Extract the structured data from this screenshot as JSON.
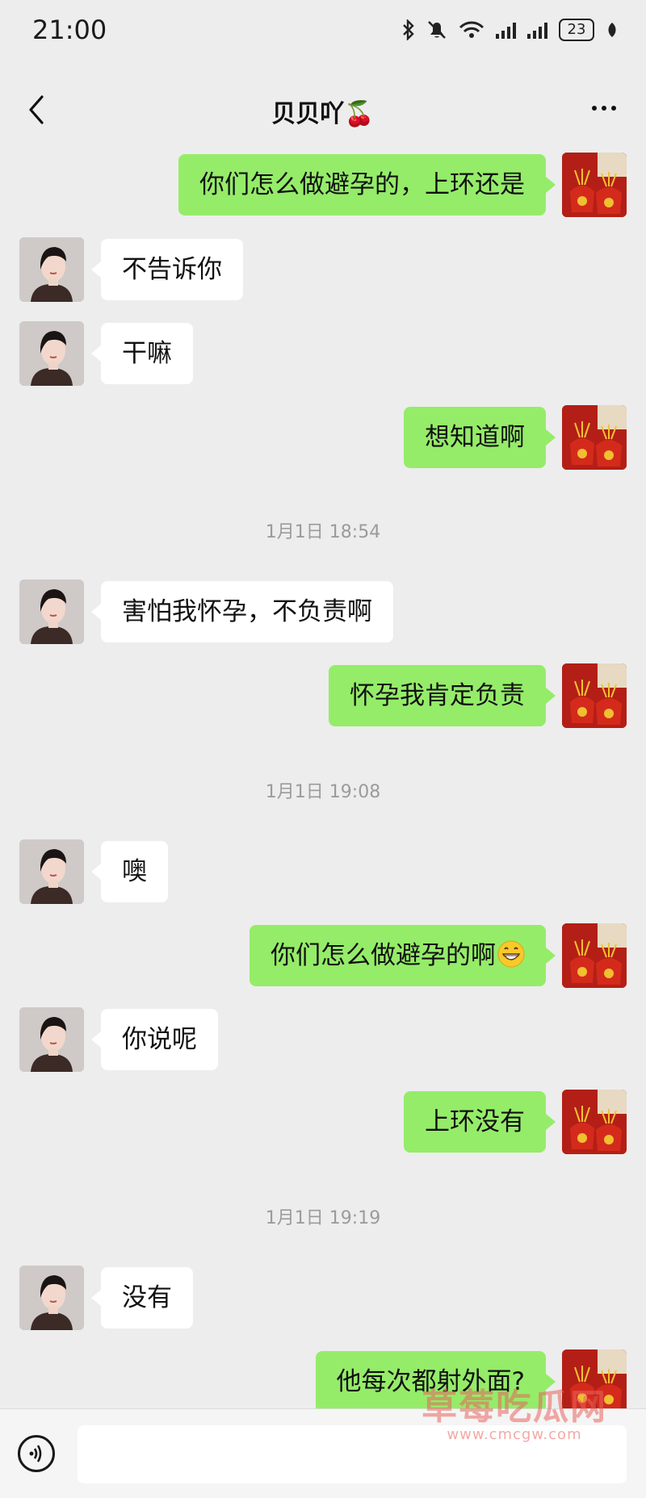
{
  "status_bar": {
    "time": "21:00",
    "battery": "23"
  },
  "header": {
    "title": "贝贝吖🍒"
  },
  "messages": [
    {
      "side": "right",
      "text": "你们怎么做避孕的，上环还是"
    },
    {
      "side": "left",
      "text": "不告诉你"
    },
    {
      "side": "left",
      "text": "干嘛"
    },
    {
      "side": "right",
      "text": "想知道啊"
    },
    {
      "time": "1月1日 18:54"
    },
    {
      "side": "left",
      "text": "害怕我怀孕，不负责啊"
    },
    {
      "side": "right",
      "text": "怀孕我肯定负责"
    },
    {
      "time": "1月1日 19:08"
    },
    {
      "side": "left",
      "text": "噢"
    },
    {
      "side": "right",
      "text": "你们怎么做避孕的啊",
      "emoji": "grinning-face"
    },
    {
      "side": "left",
      "text": "你说呢"
    },
    {
      "side": "right",
      "text": "上环没有"
    },
    {
      "time": "1月1日 19:19"
    },
    {
      "side": "left",
      "text": "没有"
    },
    {
      "side": "right",
      "text": "他每次都射外面?"
    }
  ],
  "watermark": {
    "main": "草莓吃瓜网",
    "sub": "www.cmcgw.com"
  },
  "colors": {
    "background": "#ededed",
    "sent_bubble": "#95ec69",
    "received_bubble": "#ffffff",
    "timestamp": "#9b9b9b"
  },
  "icons": {
    "back": "chevron-left-icon",
    "more": "more-dots-icon",
    "voice": "voice-icon"
  }
}
